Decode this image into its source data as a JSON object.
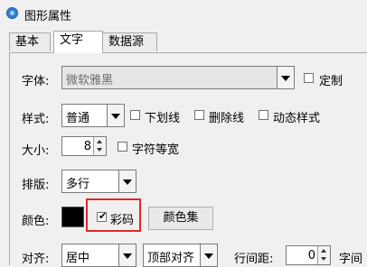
{
  "window": {
    "title": "图形属性",
    "icon": "app-icon"
  },
  "tabs": [
    {
      "label": "基本",
      "active": false
    },
    {
      "label": "文字",
      "active": true
    },
    {
      "label": "数据源",
      "active": false
    }
  ],
  "font": {
    "label": "字体:",
    "value": "微软雅黑",
    "custom_label": "定制",
    "custom_checked": false
  },
  "style": {
    "label": "样式:",
    "value": "普通",
    "underline_label": "下划线",
    "underline_checked": false,
    "strikethrough_label": "删除线",
    "strikethrough_checked": false,
    "dynamic_label": "动态样式",
    "dynamic_checked": false
  },
  "size": {
    "label": "大小:",
    "value": "8",
    "equal_width_label": "字符等宽",
    "equal_width_checked": false
  },
  "layout": {
    "label": "排版:",
    "value": "多行"
  },
  "color": {
    "label": "颜色:",
    "swatch": "#000000",
    "colorful_label": "彩码",
    "colorful_checked": true,
    "color_set_label": "颜色集",
    "highlight_color": "#e02828"
  },
  "align": {
    "label": "对齐:",
    "value": "居中",
    "vertical_value": "顶部对齐",
    "line_spacing_label": "行间距:",
    "line_spacing_value": "0",
    "char_spacing_label_partial": "字间"
  }
}
